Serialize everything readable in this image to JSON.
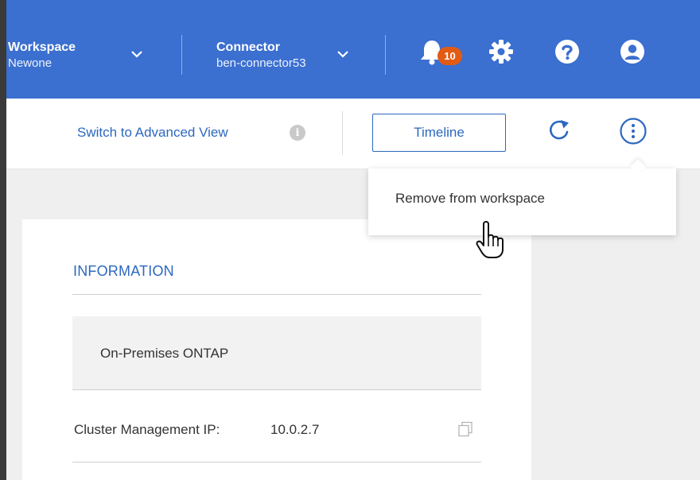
{
  "header": {
    "workspace": {
      "label": "Workspace",
      "value": "Newone"
    },
    "connector": {
      "label": "Connector",
      "value": "ben-connector53"
    },
    "notifications": {
      "count": "10"
    },
    "icons": [
      "bell-icon",
      "gear-icon",
      "help-icon",
      "user-icon",
      "chevron-down-icon"
    ]
  },
  "toolbar": {
    "advanced_view_label": "Switch to Advanced View",
    "info_glyph": "i",
    "timeline_label": "Timeline",
    "icons": [
      "info-icon",
      "refresh-icon",
      "more-vertical-icon"
    ]
  },
  "menu": {
    "items": [
      {
        "label": "Remove from workspace"
      }
    ]
  },
  "information": {
    "heading": "INFORMATION",
    "environment": "On-Premises ONTAP",
    "cluster_ip_label": "Cluster Management IP:",
    "cluster_ip_value": "10.0.2.7",
    "icons": [
      "copy-icon"
    ]
  },
  "colors": {
    "header_bg": "#3b6fd0",
    "accent": "#2c68bf",
    "badge": "#e25b14",
    "page_bg": "#efefef"
  }
}
